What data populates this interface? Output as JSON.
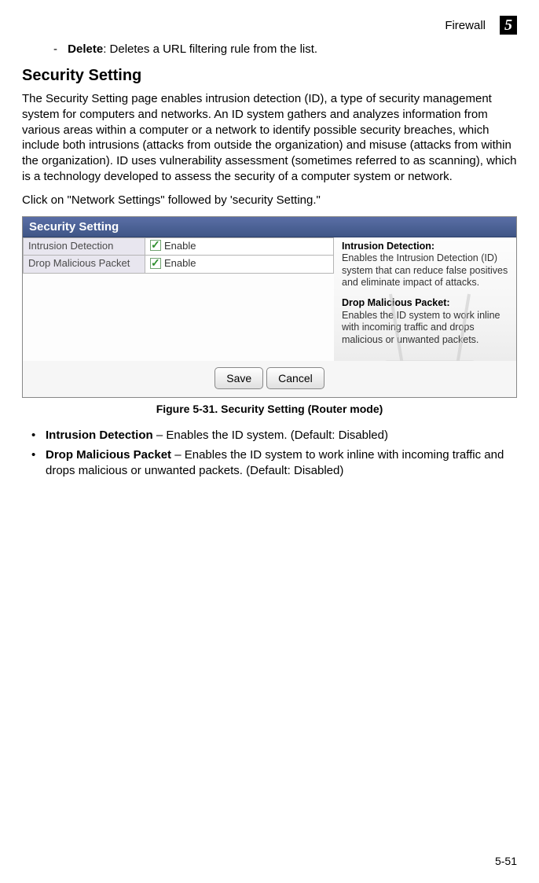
{
  "header": {
    "section": "Firewall",
    "chapter": "5"
  },
  "delete_item": {
    "label": "Delete",
    "desc": ": Deletes a URL filtering rule from the list."
  },
  "section_title": "Security Setting",
  "para1": "The Security Setting page enables intrusion detection (ID), a type of security management system for computers and networks. An ID system gathers and analyzes information from various areas within a computer or a network to identify possible security breaches, which include both intrusions (attacks from outside the organization) and misuse (attacks from within the organization). ID uses vulnerability assessment (sometimes referred to as scanning), which is a technology developed to assess the security of a computer system or network.",
  "para2": "Click on \"Network Settings\" followed by 'security Setting.\"",
  "figure": {
    "panel_title": "Security Setting",
    "rows": [
      {
        "label": "Intrusion Detection",
        "checkbox_label": "Enable"
      },
      {
        "label": "Drop Malicious Packet",
        "checkbox_label": "Enable"
      }
    ],
    "help": {
      "h1": "Intrusion Detection:",
      "p1": "Enables the Intrusion Detection (ID) system that can reduce false positives and eliminate impact of attacks.",
      "h2": "Drop Malicious Packet:",
      "p2": "Enables the ID system to work inline with incoming traffic and drops malicious or unwanted packets."
    },
    "buttons": {
      "save": "Save",
      "cancel": "Cancel"
    }
  },
  "figure_caption": "Figure 5-31.   Security Setting (Router mode)",
  "bullets": {
    "b1_label": "Intrusion Detection",
    "b1_text": " – Enables the ID system. (Default: Disabled)",
    "b2_label": "Drop Malicious Packet",
    "b2_text": " – Enables the ID system to work inline with incoming traffic and drops malicious or unwanted packets. (Default: Disabled)"
  },
  "page_number": "5-51"
}
